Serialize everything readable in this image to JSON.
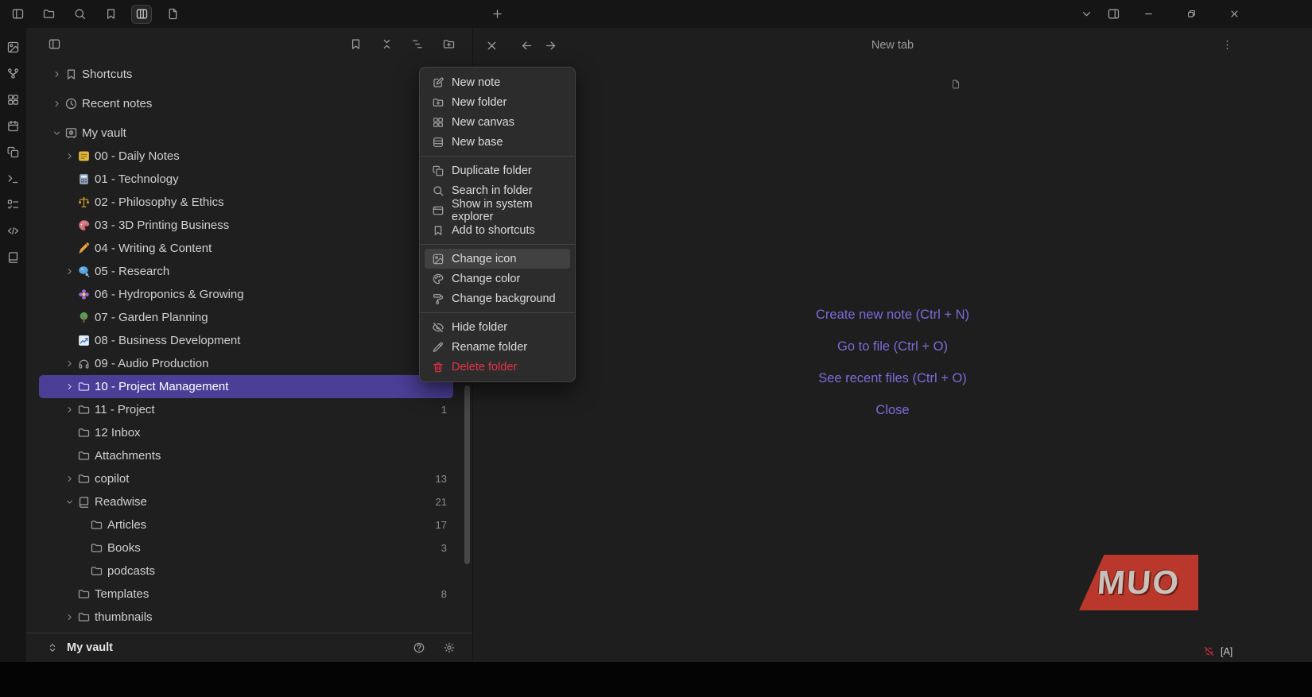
{
  "colors": {
    "accent": "#7b6cd9",
    "selected_bg": "#4b3e96",
    "danger": "#e93147",
    "watermark_red": "#b9372b"
  },
  "titlebar": {
    "left_icons": [
      {
        "name": "panel-left",
        "active": false
      },
      {
        "name": "folder",
        "active": false
      },
      {
        "name": "search",
        "active": false
      },
      {
        "name": "bookmark",
        "active": false
      },
      {
        "name": "stacked-panels",
        "active": true
      },
      {
        "name": "file",
        "active": false
      }
    ],
    "new_tab_icon": "plus",
    "right_icons": [
      {
        "name": "chevron-down",
        "win": false
      },
      {
        "name": "panel-right",
        "win": false
      },
      {
        "name": "minimize",
        "win": true
      },
      {
        "name": "restore",
        "win": true
      },
      {
        "name": "close",
        "win": true
      }
    ]
  },
  "ribbon": {
    "icons": [
      "image",
      "git-graph",
      "layout-grid",
      "calendar",
      "copy",
      "terminal",
      "list-todo",
      "code-chevrons",
      "book"
    ]
  },
  "sidebar": {
    "header": {
      "left_icon": "panel-left",
      "actions": [
        "bookmark",
        "collapse-all",
        "list-tree",
        "folder-plus"
      ]
    },
    "tree": [
      {
        "label": "Shortcuts",
        "icon": "bookmark",
        "chevron": "right",
        "level": 0,
        "section": true
      },
      {
        "label": "Recent notes",
        "icon": "clock",
        "chevron": "right",
        "level": 0,
        "section": true
      },
      {
        "label": "My vault",
        "icon": "vault",
        "chevron": "down",
        "level": 0
      },
      {
        "label": "00 - Daily Notes",
        "emoji": "note-yellow",
        "chevron": "right",
        "level": 1
      },
      {
        "label": "01 - Technology",
        "emoji": "calculator",
        "level": 1
      },
      {
        "label": "02 - Philosophy & Ethics",
        "emoji": "scales",
        "level": 1
      },
      {
        "label": "03 - 3D Printing Business",
        "emoji": "palette-art",
        "level": 1
      },
      {
        "label": "04 - Writing & Content",
        "emoji": "writing-hand",
        "level": 1
      },
      {
        "label": "05 - Research",
        "emoji": "thought-bubble",
        "chevron": "right",
        "level": 1
      },
      {
        "label": "06 - Hydroponics & Growing",
        "emoji": "flower",
        "level": 1
      },
      {
        "label": "07 - Garden Planning",
        "emoji": "tree",
        "level": 1
      },
      {
        "label": "08 - Business Development",
        "emoji": "chart-up",
        "level": 1
      },
      {
        "label": "09 - Audio Production",
        "icon": "headphones",
        "chevron": "right",
        "level": 1
      },
      {
        "label": "10 - Project Management",
        "icon": "folder",
        "chevron": "right",
        "level": 1,
        "selected": true
      },
      {
        "label": "11 - Project",
        "icon": "folder",
        "chevron": "right",
        "level": 1,
        "count": "1"
      },
      {
        "label": "12 Inbox",
        "icon": "folder",
        "level": 1
      },
      {
        "label": "Attachments",
        "icon": "folder",
        "level": 1
      },
      {
        "label": "copilot",
        "icon": "folder",
        "chevron": "right",
        "level": 1,
        "count": "13"
      },
      {
        "label": "Readwise",
        "icon": "book",
        "chevron": "down",
        "level": 1,
        "count": "21"
      },
      {
        "label": "Articles",
        "icon": "folder",
        "level": 2,
        "count": "17"
      },
      {
        "label": "Books",
        "icon": "folder",
        "level": 2,
        "count": "3"
      },
      {
        "label": "podcasts",
        "icon": "folder",
        "level": 2
      },
      {
        "label": "Templates",
        "icon": "folder",
        "level": 1,
        "count": "8"
      },
      {
        "label": "thumbnails",
        "icon": "folder",
        "chevron": "right",
        "level": 1
      }
    ],
    "footer": {
      "vault_name": "My vault",
      "switcher_icon": "chevrons-up-down",
      "actions": [
        "help",
        "settings"
      ]
    }
  },
  "context_menu": {
    "sections": [
      {
        "items": [
          {
            "label": "New note",
            "icon": "square-pen"
          },
          {
            "label": "New folder",
            "icon": "folder-plus"
          },
          {
            "label": "New canvas",
            "icon": "layout-grid"
          },
          {
            "label": "New base",
            "icon": "database"
          }
        ]
      },
      {
        "items": [
          {
            "label": "Duplicate folder",
            "icon": "copy"
          },
          {
            "label": "Search in folder",
            "icon": "search"
          },
          {
            "label": "Show in system explorer",
            "icon": "app-window"
          },
          {
            "label": "Add to shortcuts",
            "icon": "bookmark"
          }
        ]
      },
      {
        "items": [
          {
            "label": "Change icon",
            "icon": "image",
            "highlighted": true
          },
          {
            "label": "Change color",
            "icon": "palette"
          },
          {
            "label": "Change background",
            "icon": "paint-roller"
          }
        ]
      },
      {
        "items": [
          {
            "label": "Hide folder",
            "icon": "eye-off"
          },
          {
            "label": "Rename folder",
            "icon": "pencil"
          },
          {
            "label": "Delete folder",
            "icon": "trash",
            "danger": true
          }
        ]
      }
    ]
  },
  "main": {
    "header": {
      "close_icon": "x",
      "back_icon": "arrow-left",
      "forward_icon": "arrow-right",
      "tab_title": "New tab",
      "more_icon": "more-vertical"
    },
    "empty_state_links": [
      "Create new note (Ctrl + N)",
      "Go to file (Ctrl + O)",
      "See recent files (Ctrl + O)",
      "Close"
    ]
  },
  "watermark": {
    "text": "MUO"
  },
  "statusbar": {
    "icon": "sync-off",
    "lang_badge": "[A]"
  }
}
